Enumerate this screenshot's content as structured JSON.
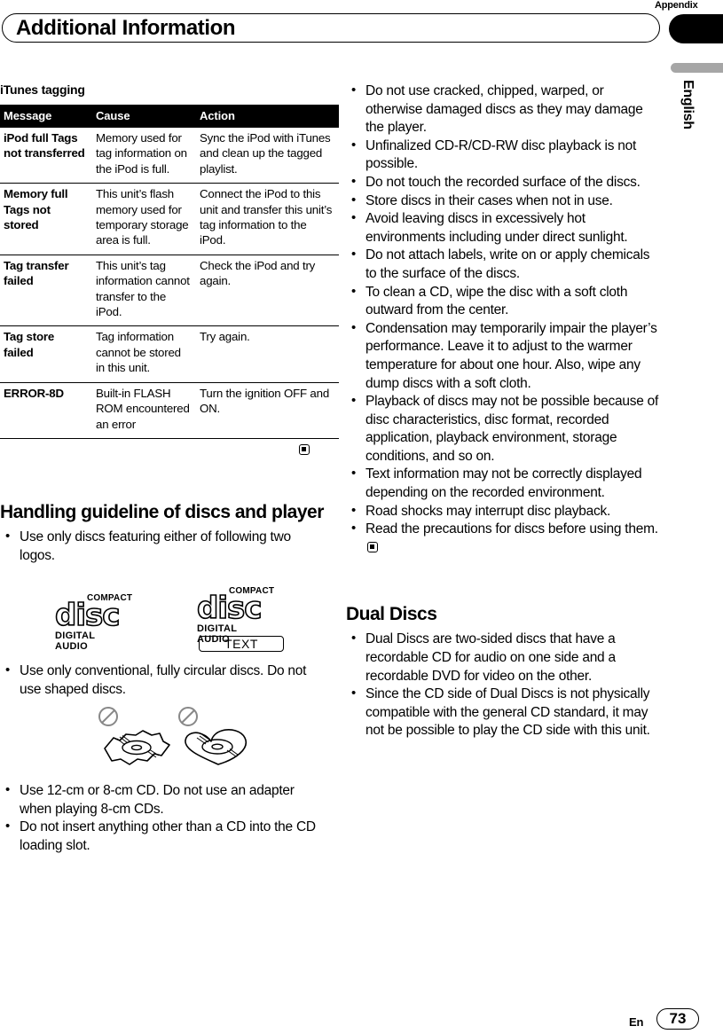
{
  "header": {
    "appendix_label": "Appendix",
    "title": "Additional Information",
    "side_tab_language": "English"
  },
  "footer": {
    "language_code": "En",
    "page_number": "73"
  },
  "left_column": {
    "subheading": "iTunes tagging",
    "table": {
      "columns": [
        "Message",
        "Cause",
        "Action"
      ],
      "rows": [
        {
          "message": "iPod full  Tags not transferred",
          "cause": "Memory used for tag information on the iPod is full.",
          "action": "Sync the iPod with iTunes and clean up the tagged playlist."
        },
        {
          "message": "Memory full Tags not stored",
          "cause": "This unit’s flash memory used for temporary storage area is full.",
          "action": "Connect the iPod to this unit and transfer this unit’s tag information to the iPod."
        },
        {
          "message": "Tag transfer failed",
          "cause": "This unit’s tag information cannot transfer to the iPod.",
          "action": "Check the iPod and try again."
        },
        {
          "message": "Tag store failed",
          "cause": "Tag information cannot be stored in this unit.",
          "action": "Try again."
        },
        {
          "message": "ERROR-8D",
          "cause": "Built-in FLASH ROM encountered an error",
          "action": "Turn the ignition OFF and ON."
        }
      ]
    },
    "handling_section": {
      "heading": "Handling guideline of discs and player",
      "bullets_before_logos": [
        "Use only discs featuring either of following two logos."
      ],
      "logos": [
        {
          "compact": "COMPACT",
          "disc": "disc",
          "digital_audio": "DIGITAL AUDIO"
        },
        {
          "compact": "COMPACT",
          "disc": "disc",
          "digital_audio": "DIGITAL AUDIO",
          "text": "TEXT"
        }
      ],
      "bullets_after_logos": [
        "Use only conventional, fully circular discs. Do not use shaped discs."
      ],
      "bullets_after_shapes": [
        "Use 12-cm or 8-cm CD. Do not use an adapter when playing 8-cm CDs.",
        "Do not insert anything other than a CD into the CD loading slot."
      ]
    }
  },
  "right_column": {
    "disc_bullets": [
      "Do not use cracked, chipped, warped, or otherwise damaged discs as they may damage the player.",
      "Unfinalized CD-R/CD-RW disc playback is not possible.",
      "Do not touch the recorded surface of the discs.",
      "Store discs in their cases when not in use.",
      "Avoid leaving discs in excessively hot environments including under direct sunlight.",
      "Do not attach labels, write on or apply chemicals to the surface of the discs.",
      "To clean a CD, wipe the disc with a soft cloth outward from the center.",
      "Condensation may temporarily impair the player’s performance. Leave it to adjust to the warmer temperature for about one hour. Also, wipe any dump discs with a soft cloth.",
      "Playback of discs may not be possible because of disc characteristics, disc format, recorded application, playback environment, storage conditions, and so on.",
      "Text information may not be correctly displayed depending on the recorded environment.",
      "Road shocks may interrupt disc playback.",
      "Read the precautions for discs before using them."
    ],
    "dual_discs": {
      "heading": "Dual Discs",
      "bullets": [
        "Dual Discs are two-sided discs that have a recordable CD for audio on one side and a recordable DVD for video on the other.",
        "Since the CD side of Dual Discs is not physically compatible with the general CD standard, it may not be possible to play the CD side with this unit."
      ]
    }
  }
}
